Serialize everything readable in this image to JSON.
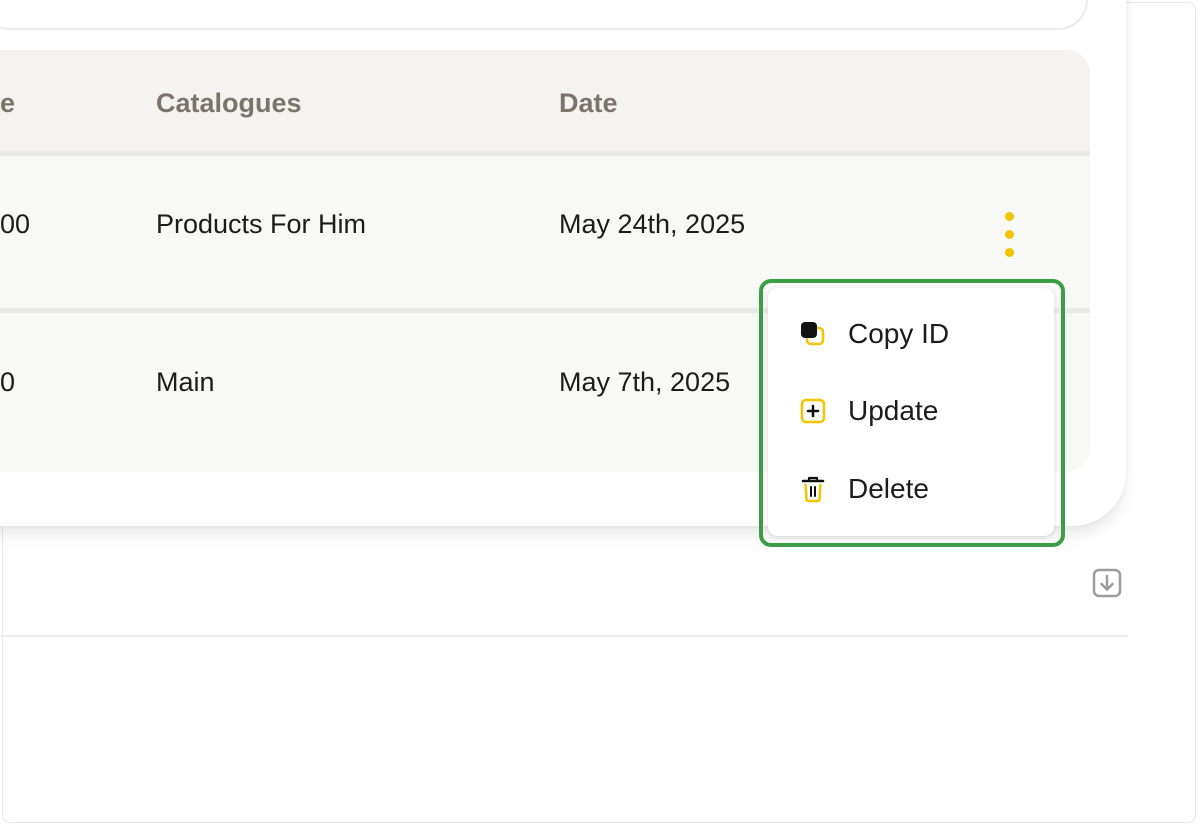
{
  "table": {
    "columns": {
      "value_partial": "e",
      "catalogues": "Catalogues",
      "date": "Date"
    },
    "rows": [
      {
        "value_partial": "00",
        "catalogue": "Products For Him",
        "date": "May 24th, 2025"
      },
      {
        "value_partial": "0",
        "catalogue": "Main",
        "date": "May 7th, 2025"
      }
    ]
  },
  "row_menu": {
    "items": [
      {
        "label": "Copy ID",
        "icon": "copy-icon"
      },
      {
        "label": "Update",
        "icon": "plus-square-icon"
      },
      {
        "label": "Delete",
        "icon": "trash-icon"
      }
    ]
  },
  "colors": {
    "accent": "#f5c400",
    "highlight": "#3b9d48",
    "header_text": "#7b746c"
  }
}
